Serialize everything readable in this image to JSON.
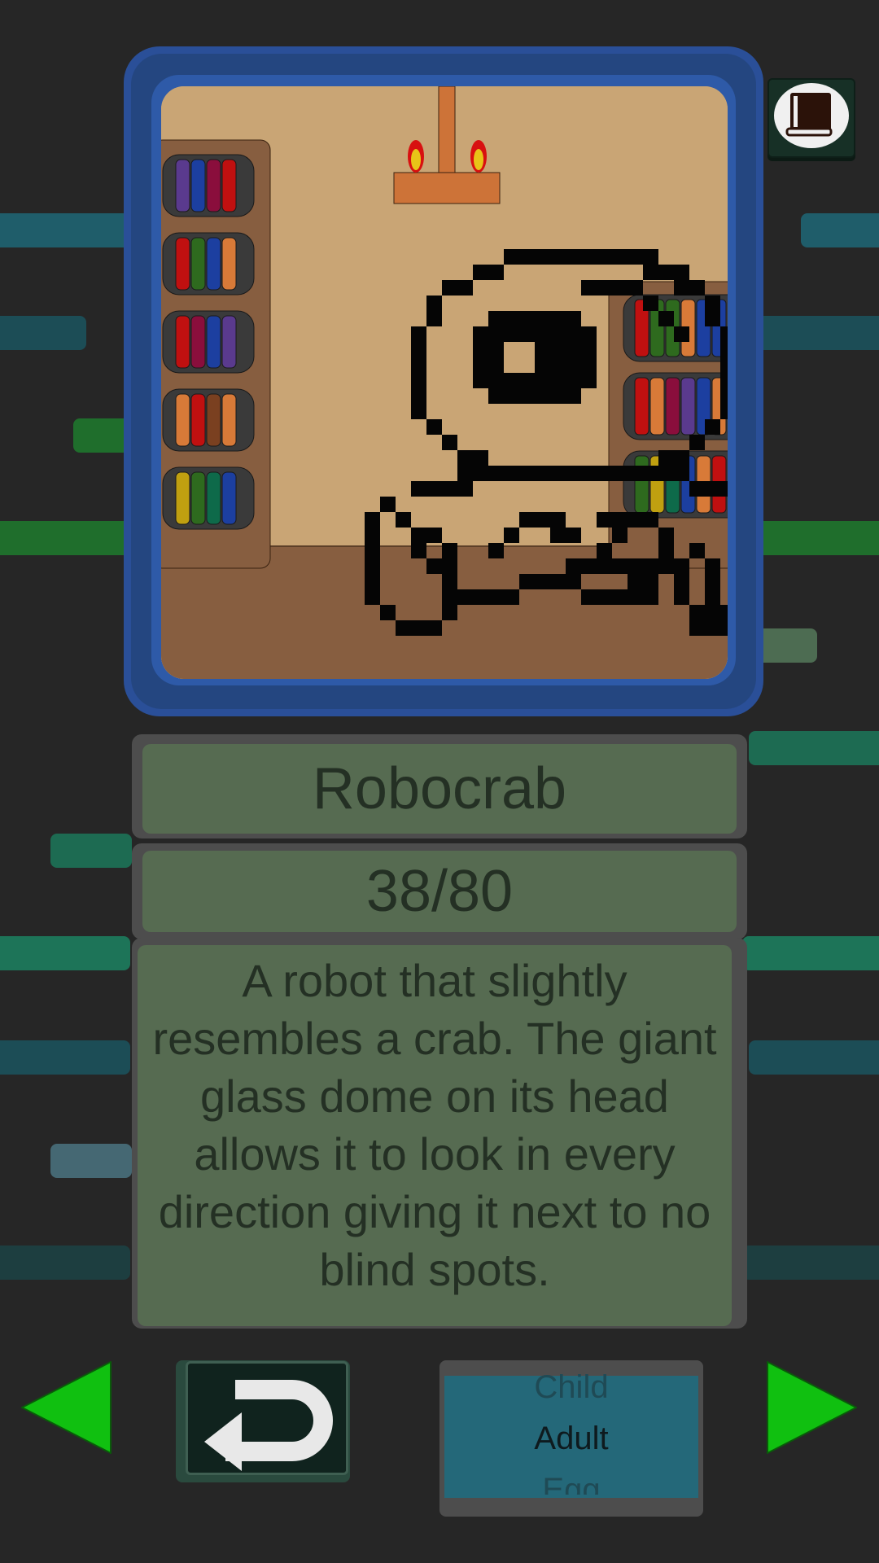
{
  "creature": {
    "name": "Robocrab",
    "progress": "38/80",
    "description": "A robot that slightly\nresembles a crab. The giant\nglass dome on its head\nallows it to look in every\ndirection giving it next to no\nblind spots."
  },
  "stage_selector": {
    "options": [
      "Child",
      "Adult",
      "Egg"
    ],
    "selected": "Adult"
  },
  "buttons": {
    "journal_icon": "book-icon",
    "back_icon": "return-arrow-icon",
    "prev_icon": "triangle-left-icon",
    "next_icon": "triangle-right-icon"
  },
  "colors": {
    "background": "#262626",
    "frame": "#2a4f98",
    "panel": "#566b51",
    "text": "#243024",
    "arrow": "#10c010",
    "stage_box": "#246879"
  }
}
